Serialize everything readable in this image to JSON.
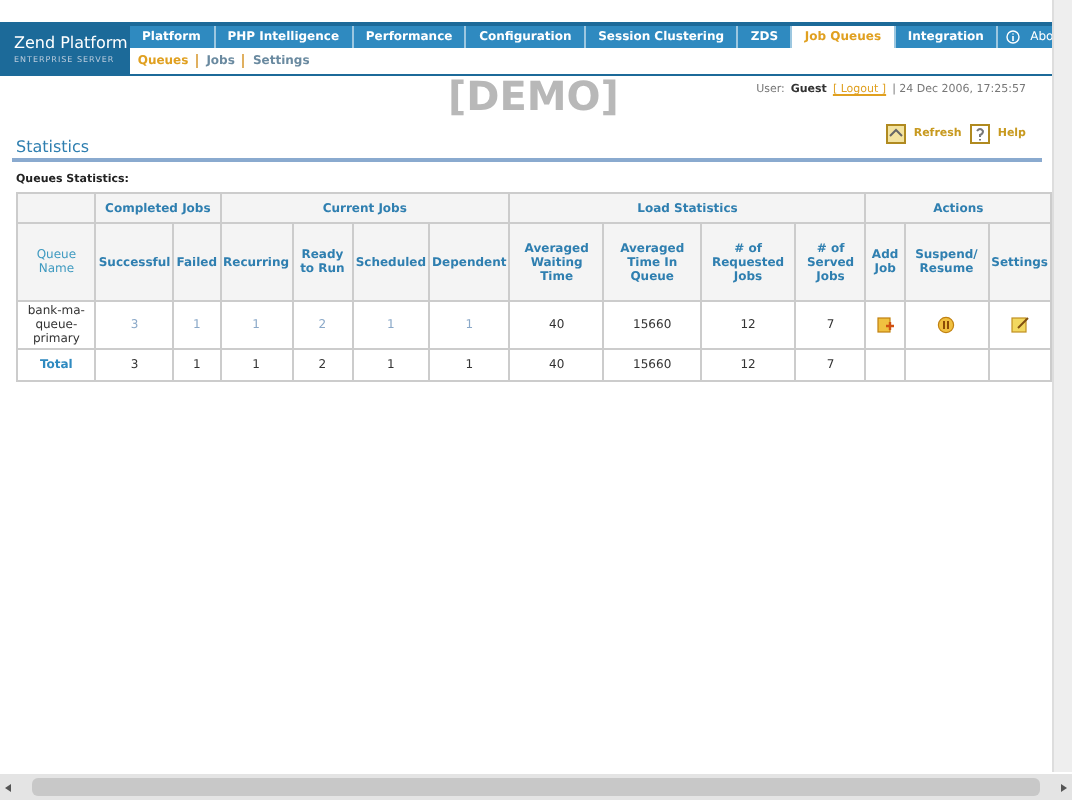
{
  "logo": {
    "title": "Zend Platform",
    "subtitle": "ENTERPRISE SERVER"
  },
  "tabs": [
    {
      "label": "Platform",
      "selected": false
    },
    {
      "label": "PHP Intelligence",
      "selected": false
    },
    {
      "label": "Performance",
      "selected": false
    },
    {
      "label": "Configuration",
      "selected": false
    },
    {
      "label": "Session Clustering",
      "selected": false
    },
    {
      "label": "ZDS",
      "selected": false
    },
    {
      "label": "Job Queues",
      "selected": true
    },
    {
      "label": "Integration",
      "selected": false
    }
  ],
  "about": "Abo",
  "subtabs": [
    {
      "label": "Queues",
      "selected": true
    },
    {
      "label": "Jobs",
      "selected": false
    },
    {
      "label": "Settings",
      "selected": false
    }
  ],
  "demo": "[DEMO]",
  "user": {
    "label": "User:",
    "name": "Guest",
    "logout": "[ Logout ]",
    "datetime": "| 24 Dec 2006, 17:25:57"
  },
  "section_title": "Statistics",
  "toolbar": [
    {
      "kind": "refresh",
      "label": "Refresh"
    },
    {
      "kind": "help",
      "label": "Help"
    }
  ],
  "table": {
    "caption": "Queues Statistics:",
    "groups": [
      {
        "label": "Completed Jobs"
      },
      {
        "label": "Current Jobs"
      },
      {
        "label": "Load Statistics"
      },
      {
        "label": "Actions"
      }
    ],
    "columns": [
      "Queue Name",
      "Successful",
      "Failed",
      "Recurring",
      "Ready to Run",
      "Scheduled",
      "Dependent",
      "Averaged Waiting Time",
      "Averaged Time In Queue",
      "# of Requested Jobs",
      "# of Served Jobs",
      "Add Job",
      "Suspend/ Resume",
      "Settings"
    ],
    "rows": [
      {
        "kind": "queue",
        "cells": [
          {
            "text": "bank-ma-queue-primary",
            "kind": "name"
          },
          {
            "text": "3",
            "kind": "link"
          },
          {
            "text": "1",
            "kind": "link"
          },
          {
            "text": "1",
            "kind": "link"
          },
          {
            "text": "2",
            "kind": "link"
          },
          {
            "text": "1",
            "kind": "link"
          },
          {
            "text": "1",
            "kind": "link"
          },
          {
            "text": "40",
            "kind": "plain"
          },
          {
            "text": "15660",
            "kind": "plain"
          },
          {
            "text": "12",
            "kind": "plain"
          },
          {
            "text": "7",
            "kind": "plain"
          }
        ],
        "actions": true
      },
      {
        "kind": "total",
        "cells": [
          {
            "text": "Total",
            "kind": "total"
          },
          {
            "text": "3",
            "kind": "plain"
          },
          {
            "text": "1",
            "kind": "plain"
          },
          {
            "text": "1",
            "kind": "plain"
          },
          {
            "text": "2",
            "kind": "plain"
          },
          {
            "text": "1",
            "kind": "plain"
          },
          {
            "text": "1",
            "kind": "plain"
          },
          {
            "text": "40",
            "kind": "plain"
          },
          {
            "text": "15660",
            "kind": "plain"
          },
          {
            "text": "12",
            "kind": "plain"
          },
          {
            "text": "7",
            "kind": "plain"
          }
        ],
        "actions": false
      }
    ]
  }
}
